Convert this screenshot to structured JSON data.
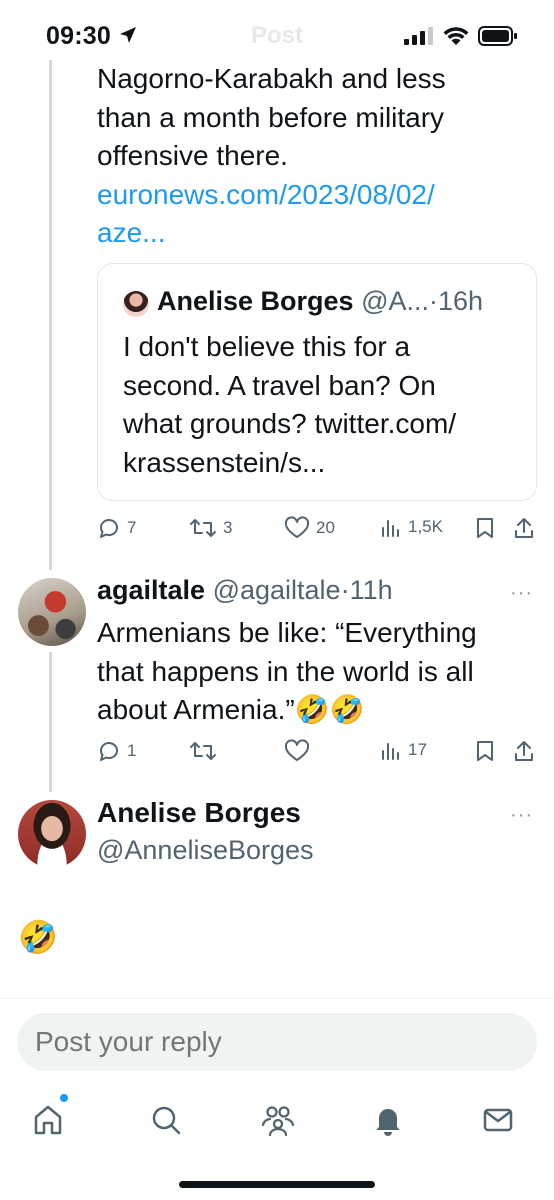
{
  "status_bar": {
    "time": "09:30",
    "faded_title": "Post"
  },
  "parent_tweet": {
    "text_lines": [
      "Nagorno-Karabakh and less",
      "than a month before military",
      "offensive there."
    ],
    "link_lines": [
      "euronews.com/2023/08/02/",
      "aze..."
    ],
    "quote": {
      "name": "Anelise Borges",
      "handle": "@A...",
      "separator": "·",
      "time": "16h",
      "text_lines": [
        "I don't believe this for a",
        "second. A travel ban? On",
        "what grounds? twitter.com/",
        "krassenstein/s..."
      ]
    },
    "actions": {
      "replies": "7",
      "reposts": "3",
      "likes": "20",
      "views": "1,5K"
    }
  },
  "reply_tweet": {
    "name": "agailtale",
    "handle": "@agailtale",
    "separator": "·",
    "time": "11h",
    "more": "···",
    "text_lines": [
      "Armenians be like: “Everything",
      "that happens in the world is all",
      "about Armenia.”🤣🤣"
    ],
    "actions": {
      "replies": "1",
      "reposts": "",
      "likes": "",
      "views": "17"
    }
  },
  "main_tweet": {
    "name": "Anelise Borges",
    "handle": "@AnneliseBorges",
    "more": "···",
    "text": "🤣"
  },
  "reply_box": {
    "placeholder": "Post your reply"
  },
  "colors": {
    "accent": "#1d9bf0",
    "text": "#0f1419",
    "secondary": "#536471"
  },
  "tabs": [
    "home-icon",
    "search-icon",
    "communities-icon",
    "notifications-icon",
    "messages-icon"
  ]
}
